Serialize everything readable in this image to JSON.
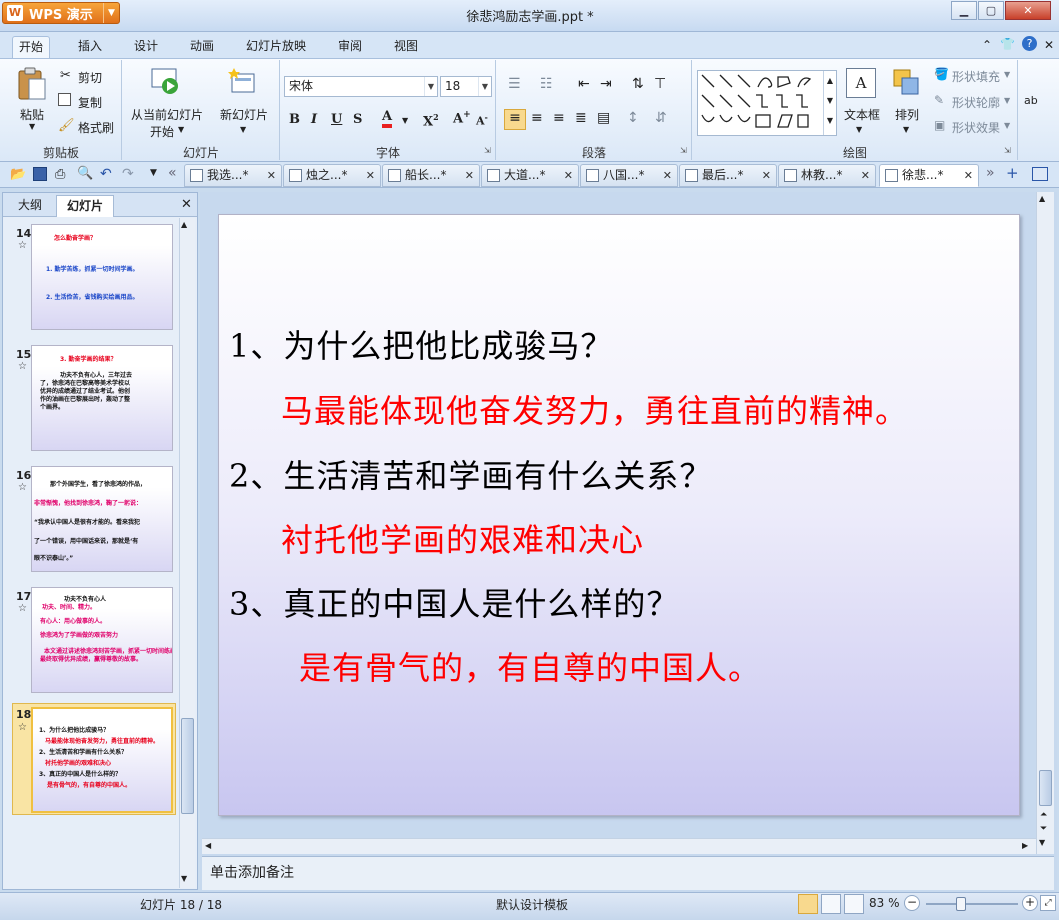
{
  "window": {
    "app_button": "WPS 演示",
    "title": "徐悲鸿励志学画.ppt *"
  },
  "menu": {
    "tabs": [
      "开始",
      "插入",
      "设计",
      "动画",
      "幻灯片放映",
      "审阅",
      "视图"
    ]
  },
  "ribbon": {
    "clipboard": {
      "paste": "粘贴",
      "cut": "剪切",
      "copy": "复制",
      "format_painter": "格式刷",
      "group": "剪贴板"
    },
    "slides": {
      "from_current_1": "从当前幻灯片",
      "from_current_2": "开始",
      "new_slide": "新幻灯片",
      "group": "幻灯片"
    },
    "font": {
      "family": "宋体",
      "size": "18",
      "group": "字体"
    },
    "paragraph": {
      "group": "段落"
    },
    "drawing": {
      "textbox": "文本框",
      "arrange": "排列",
      "shape_fill": "形状填充",
      "shape_outline": "形状轮廓",
      "shape_effect": "形状效果",
      "group": "绘图"
    }
  },
  "doc_tabs": [
    "我选...*",
    "烛之...*",
    "船长...*",
    "大道...*",
    "八国...*",
    "最后...*",
    "林教...*",
    "徐悲...*"
  ],
  "left_pane": {
    "tab_outline": "大纲",
    "tab_slides": "幻灯片"
  },
  "thumbnails": [
    {
      "num": "14",
      "lines": [
        "怎么勤奋学画？",
        "1. 勤学苦练，抓紧一切时间学画。",
        "2. 生活俭苦，省钱购买绘画用品。"
      ]
    },
    {
      "num": "15",
      "lines": [
        "3. 勤奋学画的结果？",
        "功夫不负有心人，三年过去",
        "了，徐悲鸿在巴黎高等美术学校以",
        "优异的成绩通过了结业考试。他创",
        "作的油画在巴黎展出时，轰动了整",
        "个画界。"
      ]
    },
    {
      "num": "16",
      "lines": [
        "那个外国学生，看了徐悲鸿的作品，",
        "非常惭愧，他找到徐悲鸿，鞠了一躬说：",
        "“我承认中国人是很有才能的。看来我犯",
        "了一个错误，用中国话来说，那就是‘有",
        "眼不识泰山’。”"
      ]
    },
    {
      "num": "17",
      "lines": [
        "功夫不负有心人",
        "功夫、时间、精力。",
        "有心人：用心做事的人。",
        "徐悲鸿为了学画做的艰苦努力",
        "本文通过讲述徐悲鸿刻苦学画，抓紧一切时间练画，",
        "最终取得优异成绩，赢得尊敬的故事。"
      ]
    },
    {
      "num": "18",
      "lines": [
        "1、为什么把他比成骏马？",
        "马最能体现他奋发努力，勇往直前的精神。",
        "2、生活清苦和学画有什么关系？",
        "衬托他学画的艰难和决心",
        "3、真正的中国人是什么样的？",
        "是有骨气的，有自尊的中国人。"
      ]
    }
  ],
  "slide": {
    "q1": "1、为什么把他比成骏马？",
    "a1": "马最能体现他奋发努力，勇往直前的精神。",
    "q2": "2、生活清苦和学画有什么关系？",
    "a2": "衬托他学画的艰难和决心",
    "q3": "3、真正的中国人是什么样的？",
    "a3": "是有骨气的，有自尊的中国人。"
  },
  "notes_placeholder": "单击添加备注",
  "status": {
    "slide_count": "幻灯片 18 / 18",
    "template": "默认设计模板",
    "zoom": "83 %"
  }
}
